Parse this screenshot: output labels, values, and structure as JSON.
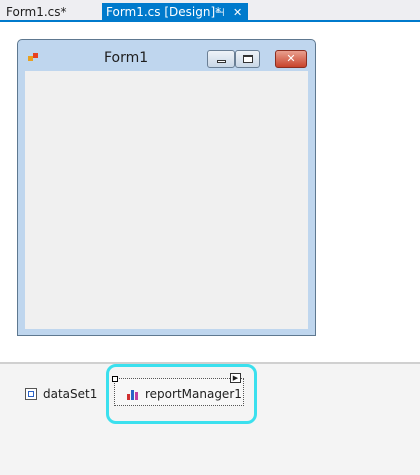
{
  "tabs": [
    {
      "label": "Form1.cs*",
      "active": false
    },
    {
      "label": "Form1.cs [Design]*",
      "active": true
    }
  ],
  "tab_icons": {
    "pin": "pin-icon",
    "close": "close-icon"
  },
  "form": {
    "title": "Form1",
    "icon": "form-app-icon",
    "buttons": [
      "minimize-icon",
      "maximize-icon",
      "close-icon"
    ]
  },
  "tray": {
    "components": [
      {
        "label": "dataSet1",
        "icon": "dataset-icon",
        "selected": false
      },
      {
        "label": "reportManager1",
        "icon": "report-chart-icon",
        "selected": true
      }
    ]
  },
  "colors": {
    "tab_active": "#007acc",
    "selection_highlight": "#3be0ee",
    "form_frame": "#bfd6ee"
  }
}
